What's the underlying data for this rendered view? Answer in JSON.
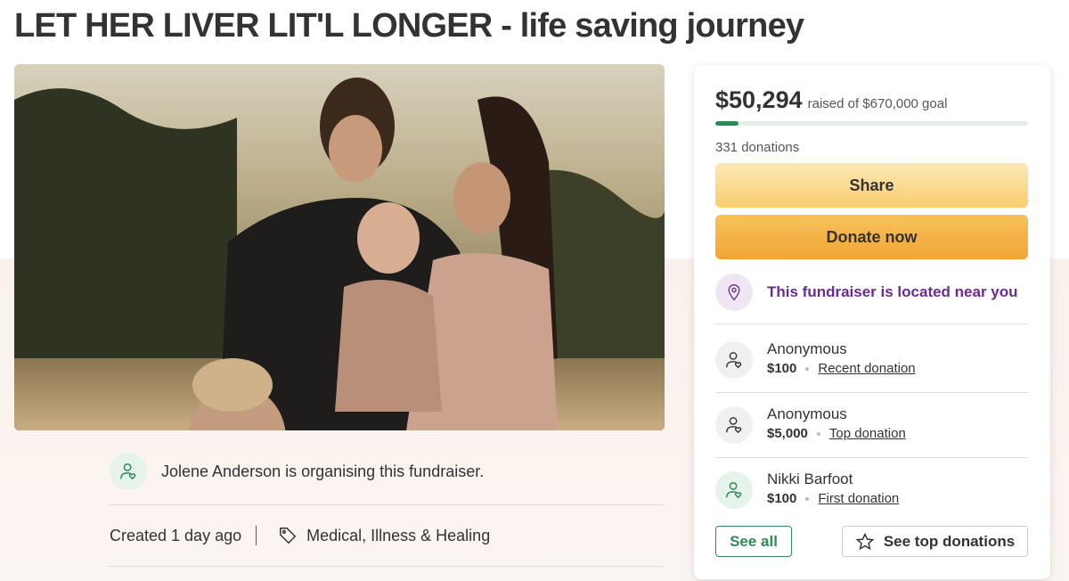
{
  "page": {
    "title": "LET HER LIVER LIT'L LONGER - life saving journey"
  },
  "organiser": {
    "text": "Jolene Anderson is organising this fundraiser."
  },
  "meta": {
    "created": "Created 1 day ago",
    "category": "Medical, Illness & Healing"
  },
  "sidebar": {
    "raised_amount": "$50,294",
    "goal_text": "raised of $670,000 goal",
    "progress_fraction": 0.075,
    "donations_count": "331 donations",
    "share_label": "Share",
    "donate_label": "Donate now",
    "near_text": "This fundraiser is located near you",
    "donors": [
      {
        "name": "Anonymous",
        "amount": "$100",
        "label": "Recent donation"
      },
      {
        "name": "Anonymous",
        "amount": "$5,000",
        "label": "Top donation"
      },
      {
        "name": "Nikki Barfoot",
        "amount": "$100",
        "label": "First donation"
      }
    ],
    "see_all_label": "See all",
    "see_top_label": "See top donations"
  },
  "colors": {
    "brand_green": "#2e8b57",
    "purple": "#6b2c91",
    "donate_orange": "#f0a534",
    "share_yellow": "#f8cc6e"
  }
}
